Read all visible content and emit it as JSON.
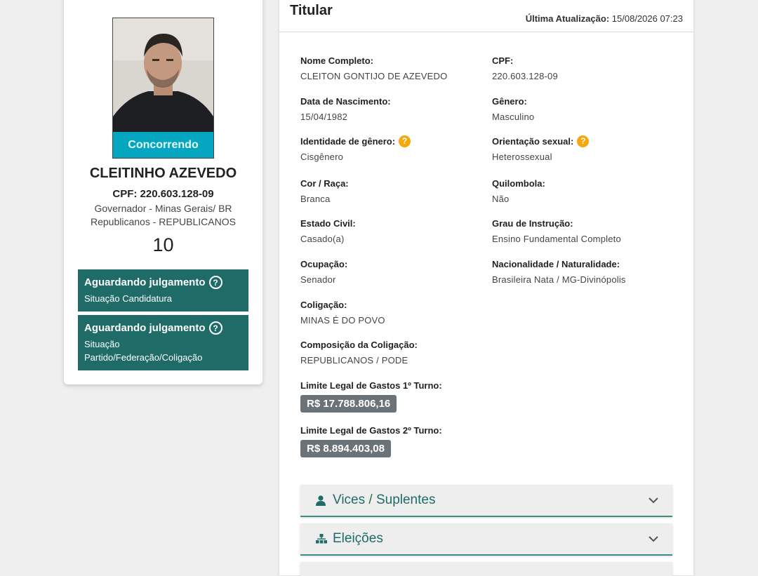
{
  "candidate": {
    "photo_badge": "Concorrendo",
    "name": "CLEITINHO AZEVEDO",
    "cpf_line": "CPF: 220.603.128-09",
    "office": "Governador - Minas Gerais/ BR",
    "party": "Republicanos - REPUBLICANOS",
    "number": "10"
  },
  "status": [
    {
      "title": "Aguardando julgamento",
      "sub": "Situação Candidatura"
    },
    {
      "title": "Aguardando julgamento",
      "sub": "Situação Partido/Federação/Coligação"
    }
  ],
  "panel": {
    "title": "Titular",
    "last_update_label": "Última Atualização:",
    "last_update_value": "15/08/2026 07:23"
  },
  "fields": {
    "nome": {
      "label": "Nome Completo:",
      "value": "CLEITON GONTIJO DE AZEVEDO"
    },
    "cpf": {
      "label": "CPF:",
      "value": "220.603.128-09"
    },
    "nascimento": {
      "label": "Data de Nascimento:",
      "value": "15/04/1982"
    },
    "genero": {
      "label": "Gênero:",
      "value": "Masculino"
    },
    "identidade": {
      "label": "Identidade de gênero:",
      "value": "Cisgênero"
    },
    "orientacao": {
      "label": "Orientação sexual:",
      "value": "Heterossexual"
    },
    "cor": {
      "label": "Cor / Raça:",
      "value": "Branca"
    },
    "quilombola": {
      "label": "Quilombola:",
      "value": "Não"
    },
    "estado_civil": {
      "label": "Estado Civil:",
      "value": "Casado(a)"
    },
    "instrucao": {
      "label": "Grau de Instrução:",
      "value": "Ensino Fundamental Completo"
    },
    "ocupacao": {
      "label": "Ocupação:",
      "value": "Senador"
    },
    "nacionalidade": {
      "label": "Nacionalidade / Naturalidade:",
      "value": "Brasileira Nata / MG-Divinópolis"
    },
    "coligacao": {
      "label": "Coligação:",
      "value": "MINAS É DO POVO"
    },
    "composicao": {
      "label": "Composição da Coligação:",
      "value": "REPUBLICANOS / PODE"
    },
    "limite1": {
      "label": "Limite Legal de Gastos 1º Turno:",
      "value": "R$ 17.788.806,16"
    },
    "limite2": {
      "label": "Limite Legal de Gastos 2º Turno:",
      "value": "R$ 8.894.403,08"
    }
  },
  "accordions": [
    {
      "label": "Vices / Suplentes",
      "icon": "person-icon"
    },
    {
      "label": "Eleições",
      "icon": "sitemap-icon"
    }
  ],
  "colors": {
    "status_bg": "#1e6b68",
    "badge_bg": "#00bedc",
    "help_icon": "#f6a70a",
    "money_badge": "#6b7278"
  }
}
